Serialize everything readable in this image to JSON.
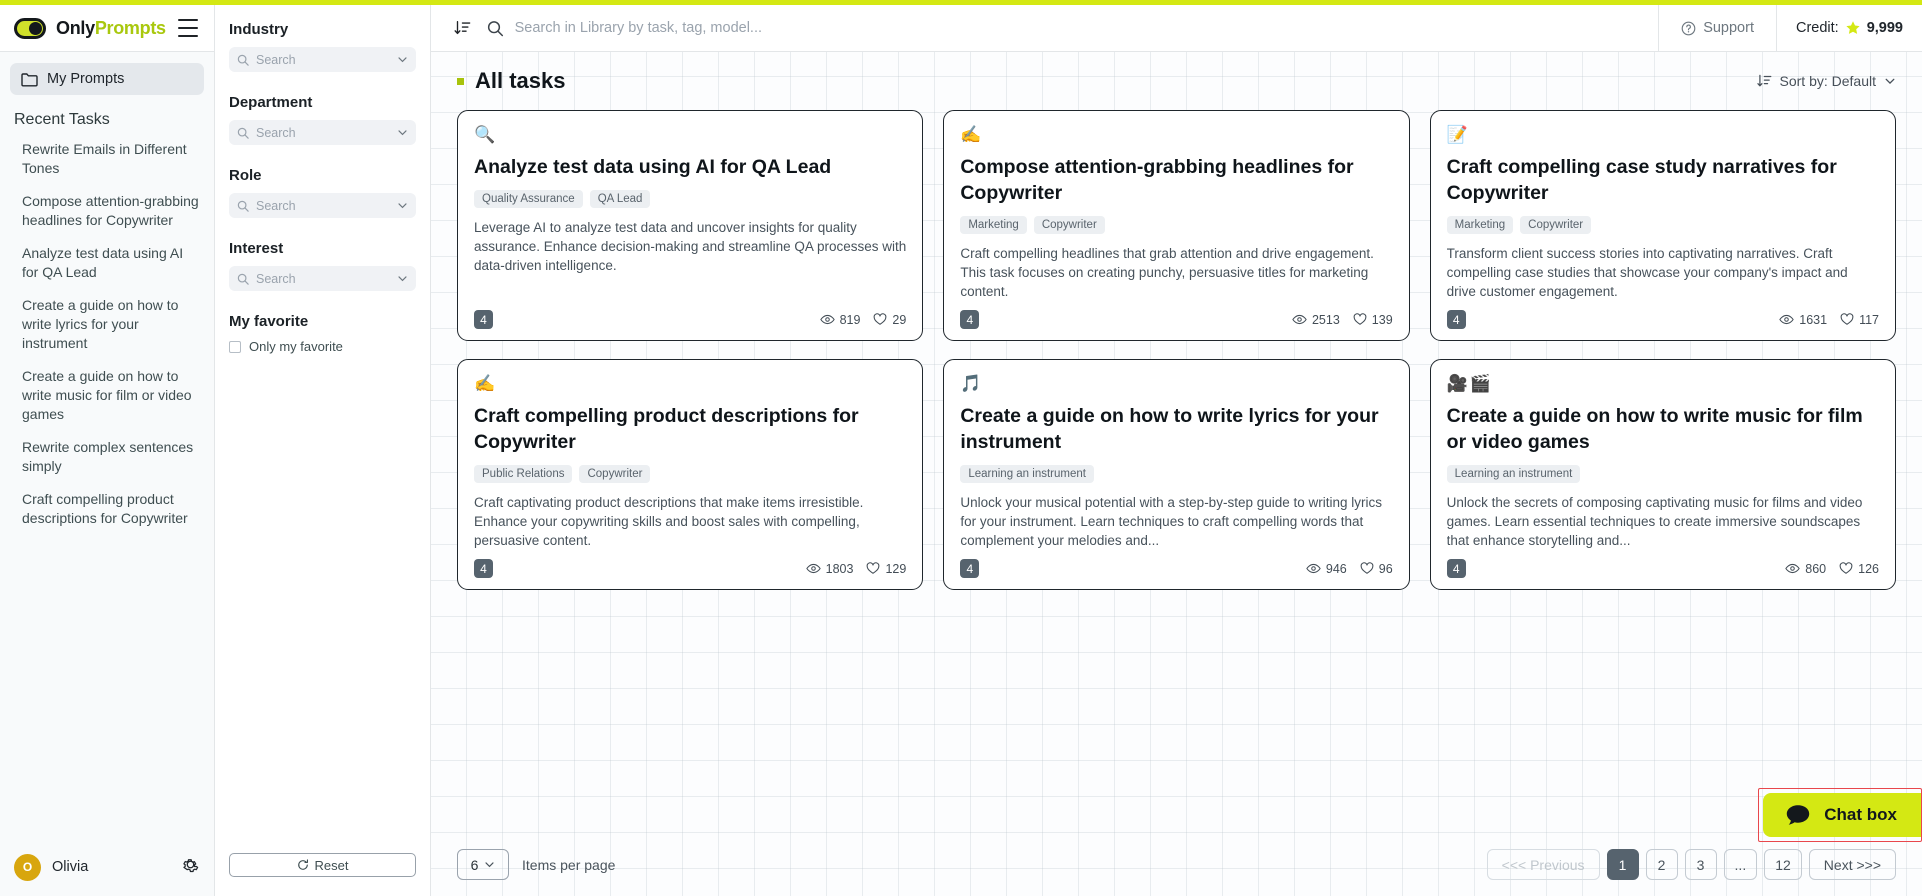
{
  "brand": {
    "only": "Only",
    "prompts": "Prompts"
  },
  "sidebar": {
    "my_prompts": "My Prompts",
    "recent_title": "Recent Tasks",
    "recent_items": [
      "Rewrite Emails in Different Tones",
      "Compose attention-grabbing headlines for Copywriter",
      "Analyze test data using AI for QA Lead",
      "Create a guide on how to write lyrics for your instrument",
      "Create a guide on how to write music for film or video games",
      "Rewrite complex sentences simply",
      "Craft compelling product descriptions for Copywriter"
    ],
    "user": {
      "initial": "O",
      "name": "Olivia"
    }
  },
  "filters": {
    "blocks": [
      {
        "label": "Industry",
        "placeholder": "Search",
        "value": ""
      },
      {
        "label": "Department",
        "placeholder": "Search",
        "value": ""
      },
      {
        "label": "Role",
        "placeholder": "Search",
        "value": ""
      },
      {
        "label": "Interest",
        "placeholder": "Search",
        "value": ""
      }
    ],
    "favorite_label": "My favorite",
    "favorite_checkbox": "Only my favorite",
    "reset": "Reset"
  },
  "topbar": {
    "search_placeholder": "Search in Library by task, tag, model...",
    "search_value": "",
    "support": "Support",
    "credit_label": "Credit:",
    "credit_value": "9,999"
  },
  "main": {
    "section_title": "All tasks",
    "sort_by": "Sort by: Default"
  },
  "cards": [
    {
      "emoji": "🔍",
      "title": "Analyze test data using AI for QA Lead",
      "tags": [
        "Quality Assurance",
        "QA Lead"
      ],
      "desc": "Leverage AI to analyze test data and uncover insights for quality assurance. Enhance decision-making and streamline QA processes with data-driven intelligence.",
      "count": "4",
      "views": "819",
      "likes": "29"
    },
    {
      "emoji": "✍️",
      "title": "Compose attention-grabbing headlines for Copywriter",
      "tags": [
        "Marketing",
        "Copywriter"
      ],
      "desc": "Craft compelling headlines that grab attention and drive engagement. This task focuses on creating punchy, persuasive titles for marketing content.",
      "count": "4",
      "views": "2513",
      "likes": "139"
    },
    {
      "emoji": "📝",
      "title": "Craft compelling case study narratives for Copywriter",
      "tags": [
        "Marketing",
        "Copywriter"
      ],
      "desc": "Transform client success stories into captivating narratives. Craft compelling case studies that showcase your company's impact and drive customer engagement.",
      "count": "4",
      "views": "1631",
      "likes": "117"
    },
    {
      "emoji": "✍️",
      "title": "Craft compelling product descriptions for Copywriter",
      "tags": [
        "Public Relations",
        "Copywriter"
      ],
      "desc": "Craft captivating product descriptions that make items irresistible. Enhance your copywriting skills and boost sales with compelling, persuasive content.",
      "count": "4",
      "views": "1803",
      "likes": "129"
    },
    {
      "emoji": "🎵",
      "title": "Create a guide on how to write lyrics for your instrument",
      "tags": [
        "Learning an instrument"
      ],
      "desc": "Unlock your musical potential with a step-by-step guide to writing lyrics for your instrument. Learn techniques to craft compelling words that complement your melodies and...",
      "count": "4",
      "views": "946",
      "likes": "96"
    },
    {
      "emoji": "🎥🎬",
      "title": "Create a guide on how to write music for film or video games",
      "tags": [
        "Learning an instrument"
      ],
      "desc": "Unlock the secrets of composing captivating music for films and video games. Learn essential techniques to create immersive soundscapes that enhance storytelling and...",
      "count": "4",
      "views": "860",
      "likes": "126"
    }
  ],
  "pagination": {
    "per_page_value": "6",
    "per_page_label": "Items per page",
    "previous": "<<< Previous",
    "pages": [
      "1",
      "2",
      "3",
      "...",
      "12"
    ],
    "active_page": "1",
    "next": "Next >>>"
  },
  "chat": {
    "label": "Chat box"
  },
  "colors": {
    "accent": "#d4e813",
    "brand_green": "#a9c80e",
    "dark": "#56636e",
    "highlight": "#e8474c"
  }
}
